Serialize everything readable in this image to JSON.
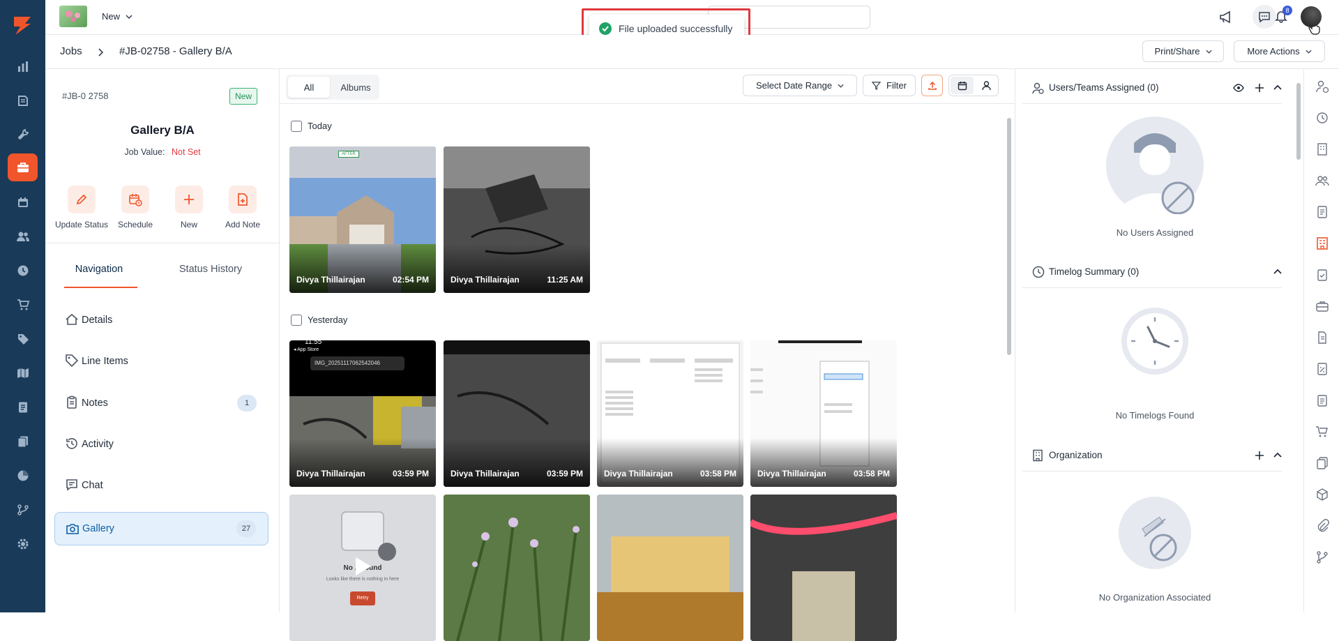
{
  "app": {
    "brand_color": "#f0552b",
    "rail_color": "#193a58",
    "accent_blue": "#0b5ea8"
  },
  "rail": {
    "items": [
      "chart-bar-icon",
      "books-icon",
      "wrench-icon",
      "briefcase-icon",
      "calendar-icon",
      "users-icon",
      "clock-icon",
      "cart-icon",
      "tag-icon",
      "map-icon",
      "invoice-icon",
      "documents-icon",
      "pie-chart-icon",
      "git-branch-icon",
      "gear-icon"
    ],
    "active_index": 3
  },
  "topbar": {
    "new_label": "New",
    "notification_count": "8"
  },
  "toast": {
    "message": "File uploaded successfully"
  },
  "breadcrumb": {
    "root": "Jobs",
    "current": "#JB-02758 - Gallery B/A"
  },
  "header_actions": {
    "print_share": "Print/Share",
    "more_actions": "More Actions"
  },
  "job": {
    "number": "#JB-0 2758",
    "status": "New",
    "title": "Gallery B/A",
    "value_label": "Job Value:",
    "value": "Not Set"
  },
  "quick_actions": [
    {
      "label": "Update Status",
      "icon": "pencil-icon"
    },
    {
      "label": "Schedule",
      "icon": "calendar-clock-icon"
    },
    {
      "label": "New",
      "icon": "plus-icon"
    },
    {
      "label": "Add Note",
      "icon": "note-plus-icon"
    }
  ],
  "left_tabs": {
    "navigation": "Navigation",
    "status_history": "Status History"
  },
  "nav": [
    {
      "label": "Details",
      "icon": "home-icon",
      "count": ""
    },
    {
      "label": "Line Items",
      "icon": "tag-icon",
      "count": ""
    },
    {
      "label": "Notes",
      "icon": "clipboard-icon",
      "count": "1"
    },
    {
      "label": "Activity",
      "icon": "history-icon",
      "count": ""
    },
    {
      "label": "Chat",
      "icon": "chat-icon",
      "count": ""
    },
    {
      "label": "Gallery",
      "icon": "camera-icon",
      "count": "27"
    }
  ],
  "gallery": {
    "tabs": {
      "all": "All",
      "albums": "Albums"
    },
    "date_range": "Select Date Range",
    "filter": "Filter",
    "groups": {
      "today": "Today",
      "yesterday": "Yesterday"
    },
    "items": [
      {
        "who": "Divya Thillairajan",
        "time": "02:54 PM",
        "badge": "AFTER"
      },
      {
        "who": "Divya Thillairajan",
        "time": "11:25 AM"
      },
      {
        "who": "Divya Thillairajan",
        "time": "03:59 PM",
        "screen_time": "11:55",
        "screen_app": "◂ App Store",
        "screen_file": "IMG_20251117062542046"
      },
      {
        "who": "Divya Thillairajan",
        "time": "03:59 PM"
      },
      {
        "who": "Divya Thillairajan",
        "time": "03:58 PM"
      },
      {
        "who": "Divya Thillairajan",
        "time": "03:58 PM"
      },
      {
        "who": "",
        "time": "",
        "video_text": "No ... found",
        "video_sub": "Looks like there is nothing in here",
        "video_btn": "Retry"
      },
      {
        "who": "",
        "time": ""
      },
      {
        "who": "",
        "time": ""
      },
      {
        "who": "",
        "time": ""
      }
    ]
  },
  "right": {
    "users_title": "Users/Teams Assigned (0)",
    "users_empty": "No Users Assigned",
    "timelog_title": "Timelog Summary (0)",
    "timelog_empty": "No Timelogs Found",
    "org_title": "Organization",
    "org_empty": "No Organization Associated"
  }
}
